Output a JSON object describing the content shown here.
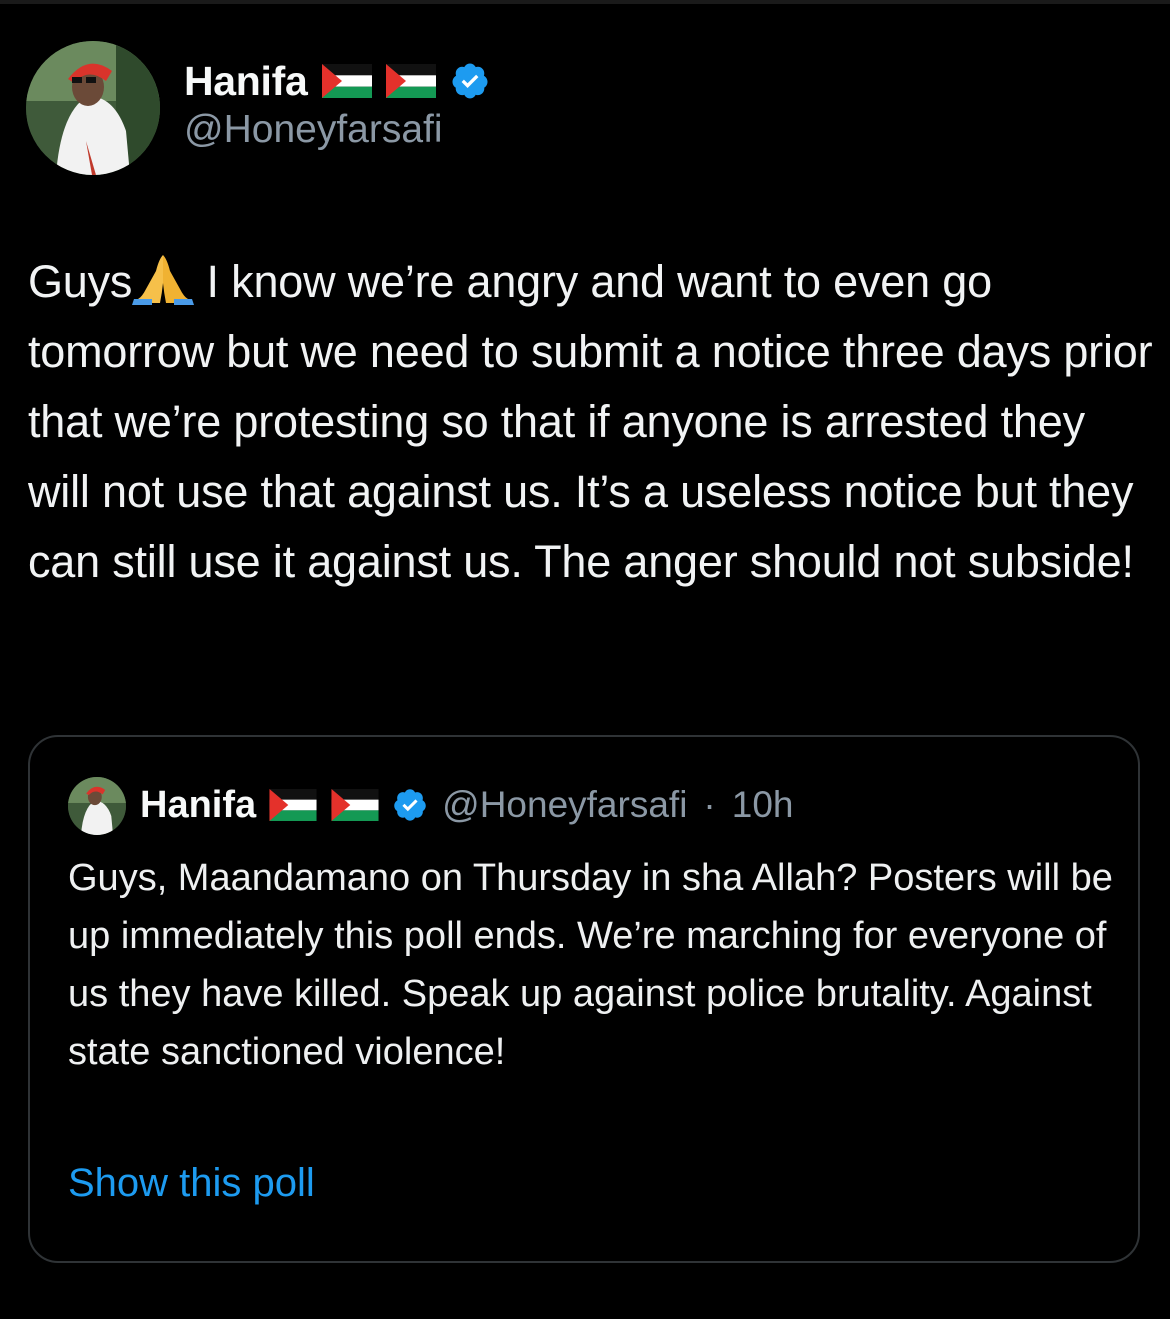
{
  "author": {
    "name": "Hanifa",
    "handle": "@Honeyfarsafi",
    "flags": [
      "palestine-flag",
      "palestine-flag"
    ],
    "verified": true
  },
  "tweet": {
    "text_before_emoji": "Guys",
    "emoji": "folded-hands",
    "text_after_emoji": " I know we’re angry and want to even go tomorrow but we need to submit a notice three days prior that we’re protesting so that if anyone is arrested they will not use that against us. It’s a useless notice but they can still use it against us. The anger should not subside!"
  },
  "quote": {
    "name": "Hanifa",
    "handle": "@Honeyfarsafi",
    "separator": "·",
    "time": "10h",
    "text": "Guys, Maandamano on Thursday in sha Allah? Posters will be up immediately this poll ends. We’re marching for everyone of us they have killed. Speak up against police brutality. Against state sanctioned violence!",
    "show_poll_label": "Show this poll"
  },
  "colors": {
    "background": "#000000",
    "text": "#e7e9ea",
    "muted": "#8b98a5",
    "link": "#1d9bf0",
    "verified": "#1d9bf0",
    "border": "#2f3336"
  }
}
